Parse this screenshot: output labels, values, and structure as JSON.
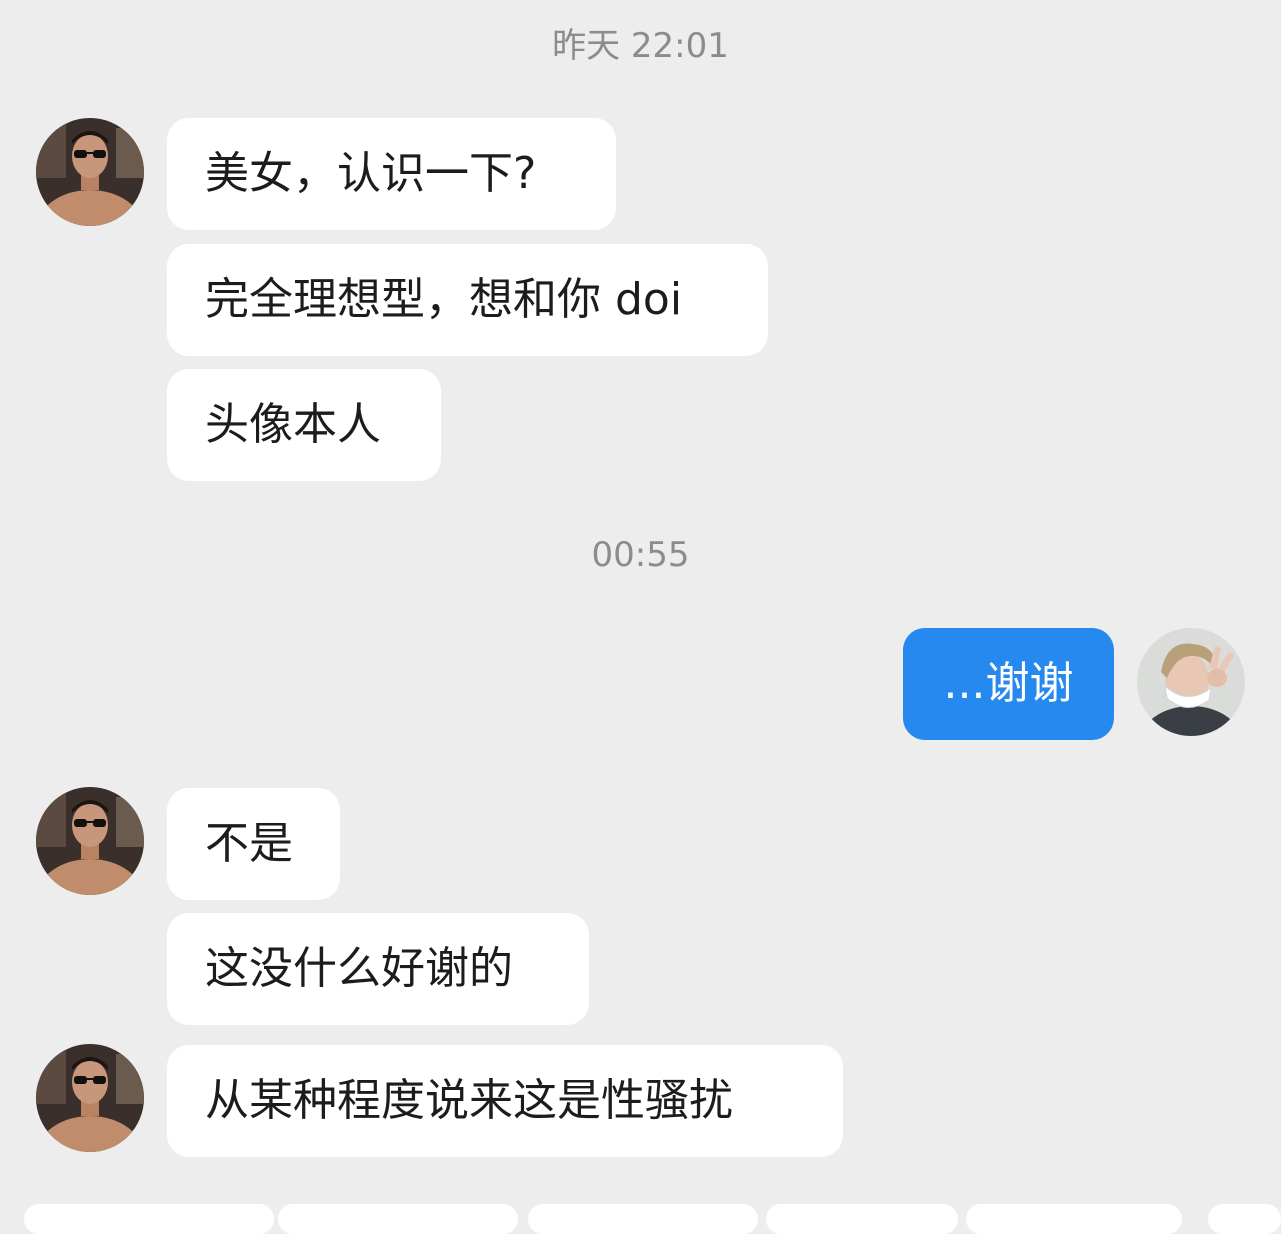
{
  "chat": {
    "time_divider_1": "昨天 22:01",
    "time_divider_2": "00:55",
    "messages": [
      {
        "sender": "other",
        "text": "美女，认识一下?"
      },
      {
        "sender": "other",
        "text": "完全理想型，想和你 doi"
      },
      {
        "sender": "other",
        "text": "头像本人"
      },
      {
        "sender": "me",
        "text": "...谢谢"
      },
      {
        "sender": "other",
        "text": "不是"
      },
      {
        "sender": "other",
        "text": "这没什么好谢的"
      },
      {
        "sender": "other",
        "text": "从某种程度说来这是性骚扰"
      }
    ]
  },
  "colors": {
    "background": "#ededed",
    "incoming_bubble": "#ffffff",
    "outgoing_bubble": "#2589f0",
    "timestamp_text": "#8c8c8c"
  },
  "icons": {
    "other_avatar": "shirtless-man-sunglasses-avatar",
    "my_avatar": "person-peace-sign-avatar"
  }
}
